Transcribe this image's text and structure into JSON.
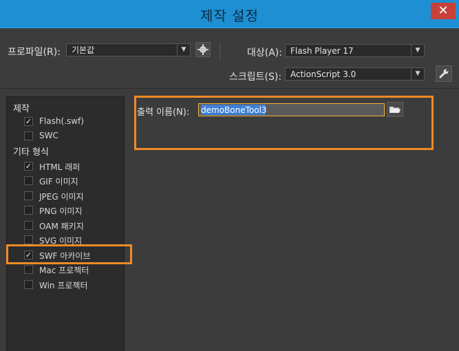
{
  "window": {
    "title": "제작 설정",
    "close_glyph": "✕"
  },
  "profile": {
    "label": "프로파일(R):",
    "value": "기본값"
  },
  "target": {
    "label": "대상(A):",
    "value": "Flash Player 17"
  },
  "script": {
    "label": "스크립트(S):",
    "value": "ActionScript 3.0"
  },
  "publish": {
    "group1_label": "제작",
    "group1_items": [
      {
        "label": "Flash(.swf)",
        "checked": true
      },
      {
        "label": "SWC",
        "checked": false
      }
    ],
    "group2_label": "기타 형식",
    "group2_items": [
      {
        "label": "HTML 래퍼",
        "checked": true
      },
      {
        "label": "GIF 이미지",
        "checked": false
      },
      {
        "label": "JPEG 이미지",
        "checked": false
      },
      {
        "label": "PNG 이미지",
        "checked": false
      },
      {
        "label": "OAM 패키지",
        "checked": false
      },
      {
        "label": "SVG 이미지",
        "checked": false
      },
      {
        "label": "SWF 아카이브",
        "checked": true
      },
      {
        "label": "Mac 프로젝터",
        "checked": false
      },
      {
        "label": "Win 프로젝터",
        "checked": false
      }
    ]
  },
  "output": {
    "label": "출력 이름(N):",
    "value": "demoBoneTool3"
  },
  "colors": {
    "highlight": "#f28a27",
    "titlebar": "#1f8fd3",
    "panel": "#2c2c2c"
  }
}
